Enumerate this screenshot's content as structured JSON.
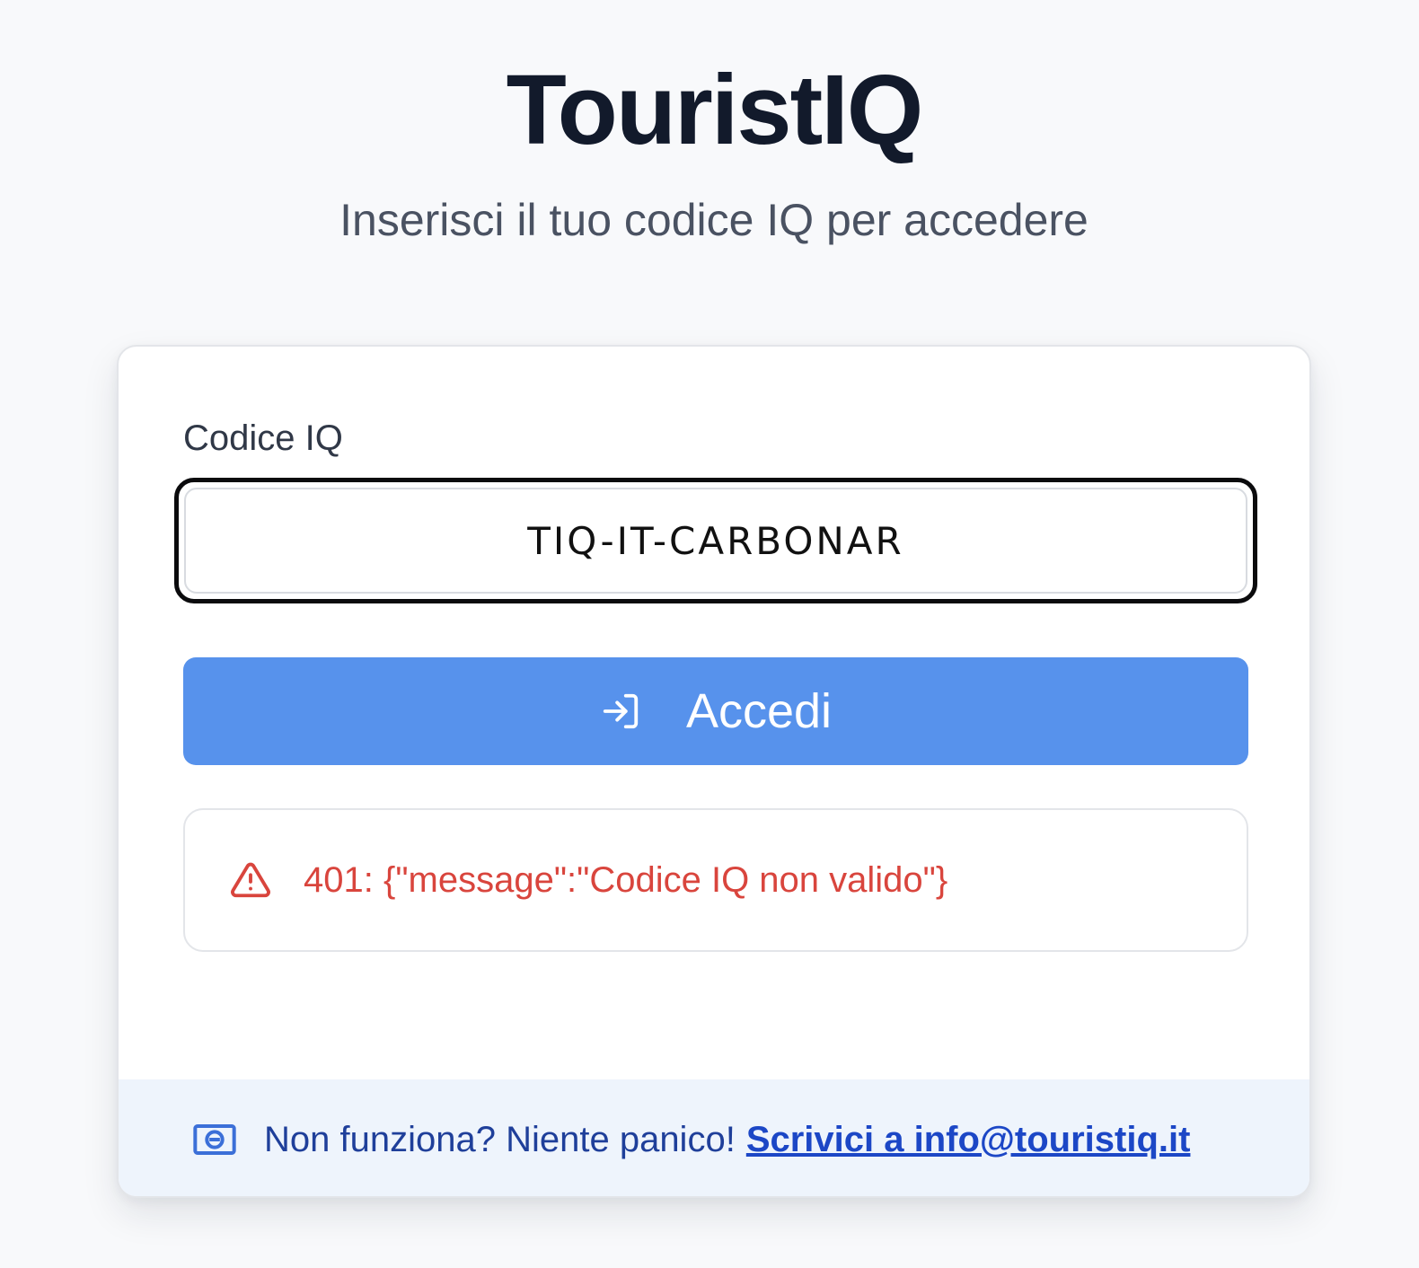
{
  "header": {
    "title": "TouristIQ",
    "subtitle": "Inserisci il tuo codice IQ per accedere"
  },
  "login": {
    "code_label": "Codice IQ",
    "code_value": "TIQ-IT-CARBONAR",
    "submit_label": "Accedi",
    "submit_icon": "log-in-icon"
  },
  "error": {
    "icon": "warning-triangle-icon",
    "message": "401: {\"message\":\"Codice IQ non valido\"}"
  },
  "help": {
    "icon": "mail-icon",
    "text": "Non funziona? Niente panico!",
    "link_text": "Scrivici a info@touristiq.it"
  },
  "colors": {
    "accent": "#5792ec",
    "error": "#d9453d",
    "link": "#1c47c6",
    "footer_bg": "#eef4fc"
  }
}
